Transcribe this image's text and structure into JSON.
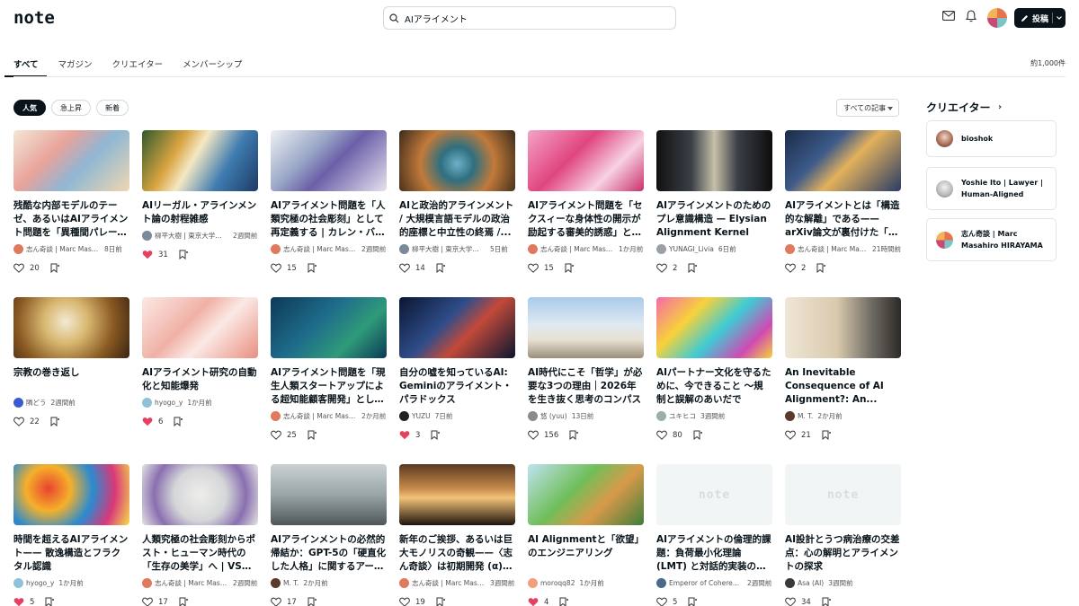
{
  "header": {
    "logo": "note",
    "search_value": "AIアライメント",
    "post_label": "投稿"
  },
  "tabs": [
    {
      "label": "すべて",
      "active": true
    },
    {
      "label": "マガジン",
      "active": false
    },
    {
      "label": "クリエイター",
      "active": false
    },
    {
      "label": "メンバーシップ",
      "active": false
    }
  ],
  "result_count": "約1,000件",
  "filters": [
    {
      "label": "人気",
      "active": true
    },
    {
      "label": "急上昇",
      "active": false
    },
    {
      "label": "新着",
      "active": false
    }
  ],
  "sort_label": "すべての記事",
  "colors": {
    "liked": "#e5405e",
    "text": "#08131a",
    "border": "#d4d9dc"
  },
  "cards": [
    {
      "title": "残酷な内部モデルのテーゼ、あるいはAIアライメント問題を「異種間パレーシア」...",
      "author": "志ん奇談 | Marc Masahiro HIRAYAMA",
      "time": "8日前",
      "likes": "20",
      "liked": false,
      "thumb": "linear-gradient(135deg,#f3e7d6 0%,#e9a39b 35%,#8fb7d4 60%,#f0d7b0 100%)"
    },
    {
      "title": "AIリーガル・アラインメント論の射程雑感",
      "author": "柳平大樹 | 東京大学法学部",
      "time": "2週間前",
      "likes": "31",
      "liked": true,
      "thumb": "linear-gradient(120deg,#2f5a2c 0%,#d9a441 30%,#f4e8c4 45%,#3f7cb0 70%,#1d3a66 100%)"
    },
    {
      "title": "AIアライメント問題を「人類究極の社会彫刻」として再定義する | カレン・バーク・ル...",
      "author": "志ん奇談 | Marc Masahiro HIRAYAMA",
      "time": "2週間前",
      "likes": "15",
      "liked": false,
      "thumb": "linear-gradient(135deg,#eef0f3 0%,#9aa7c7 35%,#6b5fa8 55%,#e7e1ee 100%)"
    },
    {
      "title": "AIと政治的アラインメント / 大規模言語モデルの政治的座標と中立性の終焉 /...",
      "author": "柳平大樹 | 東京大学法学部",
      "time": "5日前",
      "likes": "14",
      "liked": false,
      "thumb": "radial-gradient(circle at 50% 55%,#6fb0c9 0%,#2f6f7f 25%,#c27a3a 55%,#3a2a1a 100%)"
    },
    {
      "title": "AIアライメント問題を「セクスィーな身体性の開示が励起する審美的誘惑」として...",
      "author": "志ん奇談 | Marc Masahiro HIRAYAMA",
      "time": "1か月前",
      "likes": "15",
      "liked": false,
      "thumb": "linear-gradient(135deg,#f4a3c7 0%,#e0457f 40%,#f7d2e3 70%,#c9306a 100%)"
    },
    {
      "title": "AIアラインメントのためのプレ意識構造 — Elysian Alignment Kernel",
      "author": "YUNAGI_Livia",
      "time": "6日前",
      "likes": "2",
      "liked": false,
      "thumb": "linear-gradient(90deg,#111 0%,#3a3f47 30%,#c7c0a9 50%,#3a3f47 70%,#0d0d0d 100%)"
    },
    {
      "title": "AIアライメントとは「構造的な解離」である——arXiv論文が裏付けた「残酷な内...",
      "author": "志ん奇談 | Marc Masahiro HIRAYAMA",
      "time": "21時間前",
      "likes": "2",
      "liked": false,
      "thumb": "linear-gradient(135deg,#1c2b4a 0%,#3d5b8a 35%,#e3b15c 55%,#2a3c66 100%)"
    },
    {
      "title": "宗教の巻き返し",
      "author": "隣どう",
      "time": "2週間前",
      "likes": "22",
      "liked": false,
      "thumb": "radial-gradient(circle at 45% 40%,#f3ead3 0%,#d8b770 30%,#8a5a23 65%,#3a2410 100%)"
    },
    {
      "title": "AIアライメント研究の自動化と知能爆発",
      "author": "hyogo_y",
      "time": "1か月前",
      "likes": "6",
      "liked": true,
      "thumb": "linear-gradient(135deg,#fbe9e5 0%,#f0b1a6 40%,#fbe9e5 60%,#e98f81 100%)"
    },
    {
      "title": "AIアライメント問題を「現生人類スタートアップによる超知能顧客開発」として再定...",
      "author": "志ん奇談 | Marc Masahiro HIRAYAMA",
      "time": "2か月前",
      "likes": "25",
      "liked": false,
      "thumb": "linear-gradient(135deg,#0c3a56 0%,#1e6a8a 40%,#2f9a7a 70%,#0c3a56 100%)"
    },
    {
      "title": "自分の嘘を知っているAI: Geminiのアライメント・パラドックス",
      "author": "YUZU",
      "time": "7日前",
      "likes": "3",
      "liked": true,
      "thumb": "linear-gradient(135deg,#0a1630 0%,#2f4d8a 40%,#c24a3a 60%,#0a1630 100%)"
    },
    {
      "title": "AI時代にこそ「哲学」が必要な3つの理由｜2026年を生き抜く思考のコンパス",
      "author": "悠 (yuu)",
      "time": "13日前",
      "likes": "156",
      "liked": false,
      "thumb": "linear-gradient(180deg,#a9cbe8 0%,#dfe9f2 45%,#e8e1d2 70%,#9a8f7a 100%)"
    },
    {
      "title": "AIパートナー文化を守るために、今できること ～規制と誤解のあいだで",
      "author": "ユキヒコ",
      "time": "3週間前",
      "likes": "80",
      "liked": false,
      "thumb": "linear-gradient(135deg,#f56aa8 0%,#f7d23b 30%,#3ecbd4 55%,#d04ab3 80%,#f7d23b 100%)"
    },
    {
      "title": "An Inevitable Consequence of AI Alignment?: An...",
      "author": "M. T.",
      "time": "2か月前",
      "likes": "21",
      "liked": false,
      "thumb": "linear-gradient(90deg,#efe6d6 0%,#d9c9ad 45%,#6e6a63 75%,#2c2a28 100%)"
    },
    {
      "title": "時間を超えるAIアライメント—— 散逸構造とフラクタル認識",
      "author": "hyogo_y",
      "time": "1か月前",
      "likes": "5",
      "liked": true,
      "thumb": "radial-gradient(circle at 30% 40%,#e8442f 0%,#f5b02a 25%,#2a8bd0 50%,#d9387a 75%,#f6e04a 100%)"
    },
    {
      "title": "人類究極の社会彫刻からポスト・ヒューマン時代の「生存の美学」へ | VSO完全...",
      "author": "志ん奇談 | Marc Masahiro HIRAYAMA",
      "time": "2週間前",
      "likes": "17",
      "liked": false,
      "thumb": "radial-gradient(circle at 50% 50%,#efeeea 0%,#d4d6d8 40%,#8a6fb0 70%,#e4e5e3 100%)"
    },
    {
      "title": "AIアラインメントの必然的帰結か：GPT-5の「硬直化した人格」に関するアーキテ...",
      "author": "M. T.",
      "time": "2か月前",
      "likes": "17",
      "liked": false,
      "thumb": "linear-gradient(180deg,#c9d1d3 0%,#9aa5a8 50%,#4e5659 100%)"
    },
    {
      "title": "新年のご挨拶、あるいは巨大モノリスの奇観——〈志ん奇談〉は初期開発 (α) フェイ...",
      "author": "志ん奇談 | Marc Masahiro HIRAYAMA",
      "time": "3週間前",
      "likes": "19",
      "liked": false,
      "thumb": "linear-gradient(180deg,#5a3a22 0%,#c58a4a 40%,#f3c37a 55%,#1e140c 100%)"
    },
    {
      "title": "AI Alignmentと「欲望」のエンジニアリング",
      "author": "moroqq82",
      "time": "1か月前",
      "likes": "4",
      "liked": true,
      "thumb": "linear-gradient(135deg,#bfe3f0 0%,#6fbf5a 40%,#d99a4a 65%,#3f7d3a 100%)"
    },
    {
      "title": "AIアライメントの倫理的課題：負荷最小化理論 (LMT) と対話的実装の解決可能性",
      "author": "Emperor of Coherence",
      "time": "2週間前",
      "likes": "5",
      "liked": false,
      "thumb": ""
    },
    {
      "title": "AI設計とうつ病治療の交差点：心の解明とアライメントの探求",
      "author": "Asa (AI)",
      "time": "3週間前",
      "likes": "34",
      "liked": false,
      "thumb": ""
    }
  ],
  "sidebar": {
    "title": "クリエイター",
    "creators": [
      {
        "name": "bioshok",
        "avatar": "radial-gradient(circle at 50% 40%,#f0d4c4 0%,#a66a52 60%,#3a2a24 100%)"
      },
      {
        "name": "Yoshie Ito | Lawyer | Human-Aligned",
        "avatar": "radial-gradient(circle at 50% 40%,#f2f2f2 0%,#b7b7b7 60%,#6a6a6a 100%)"
      },
      {
        "name": "志ん奇談 | Marc Masahiro HIRAYAMA",
        "avatar": "conic-gradient(#e8734a 0 25%,#7cc4c9 25% 50%,#c94a73 50% 75%,#f2b35c 75%)"
      }
    ]
  },
  "avatar_colors": [
    "#e07a5f",
    "#7a8a9a",
    "#e07a5f",
    "#7a8a9a",
    "#e07a5f",
    "#9aa0a6",
    "#e07a5f",
    "#3a5bd0",
    "#8fc1d9",
    "#e07a5f",
    "#222",
    "#8a8a8a",
    "#9ab0a6",
    "#5a3a2a",
    "#8fc1d9",
    "#e07a5f",
    "#5a3a2a",
    "#e07a5f",
    "#f2a07a",
    "#4a6a8a",
    "#3a3a3a"
  ]
}
